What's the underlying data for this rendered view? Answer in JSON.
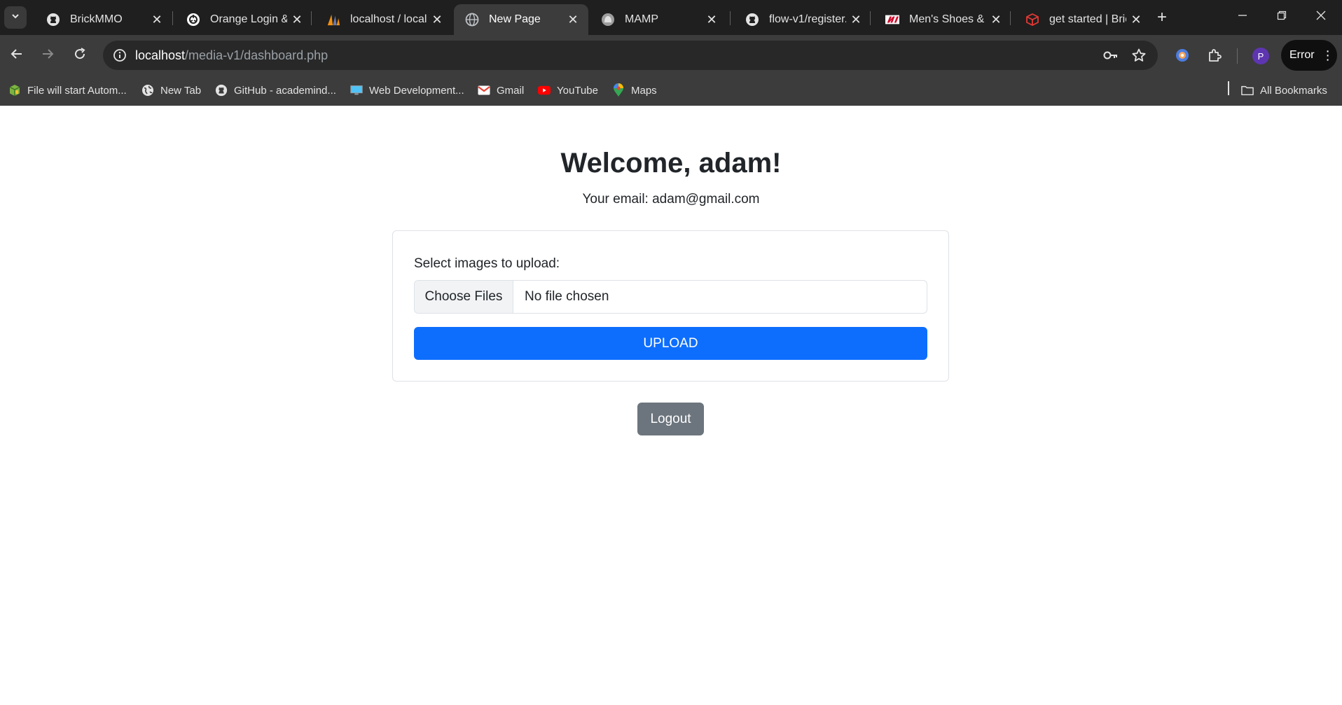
{
  "browser": {
    "tabs": [
      {
        "title": "BrickMMO",
        "icon": "github-icon",
        "active": false
      },
      {
        "title": "Orange Login &",
        "icon": "openai-icon",
        "active": false
      },
      {
        "title": "localhost / localh",
        "icon": "phpmyadmin-icon",
        "active": false
      },
      {
        "title": "New Page",
        "icon": "globe-icon",
        "active": true
      },
      {
        "title": "MAMP",
        "icon": "mamp-icon",
        "active": false
      },
      {
        "title": "flow-v1/register.",
        "icon": "github-icon",
        "active": false
      },
      {
        "title": "Men's Shoes & S",
        "icon": "new-balance-icon",
        "active": false
      },
      {
        "title": "get started | Bric",
        "icon": "cube-icon",
        "active": false
      }
    ],
    "address": {
      "host": "localhost",
      "path": "/media-v1/dashboard.php"
    },
    "profile_initial": "P",
    "error_label": "Error",
    "bookmarks": [
      {
        "label": "File will start Autom...",
        "icon": "package-icon"
      },
      {
        "label": "New Tab",
        "icon": "globe-icon"
      },
      {
        "label": "GitHub - academind...",
        "icon": "github-icon"
      },
      {
        "label": "Web Development...",
        "icon": "monitor-icon"
      },
      {
        "label": "Gmail",
        "icon": "gmail-icon"
      },
      {
        "label": "YouTube",
        "icon": "youtube-icon"
      },
      {
        "label": "Maps",
        "icon": "maps-icon"
      }
    ],
    "all_bookmarks_label": "All Bookmarks"
  },
  "page": {
    "welcome": "Welcome, adam!",
    "email_line": "Your email: adam@gmail.com",
    "upload_form": {
      "label": "Select images to upload:",
      "choose_button": "Choose Files",
      "file_status": "No file chosen",
      "submit_label": "UPLOAD"
    },
    "logout_label": "Logout"
  },
  "colors": {
    "primary": "#0d6efd",
    "secondary": "#6c757d",
    "text": "#212529",
    "tab_strip": "#1f1f1f",
    "toolbar": "#3c3c3c"
  }
}
